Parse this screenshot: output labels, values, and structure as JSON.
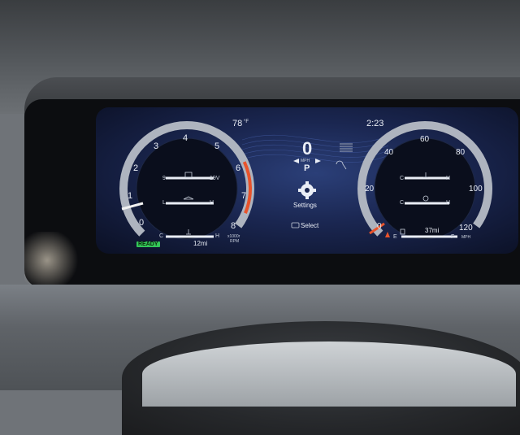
{
  "status": {
    "temperature": "78",
    "temp_unit": "°F",
    "time": "2:23"
  },
  "center": {
    "speed": "0",
    "speed_unit": "MPH",
    "gear": "P",
    "settings_label": "Settings",
    "select_label": "Select"
  },
  "tach": {
    "ticks": [
      "0",
      "1",
      "2",
      "3",
      "4",
      "5",
      "6",
      "7",
      "8"
    ],
    "unit_line1": "x1000r",
    "unit_line2": "RPM",
    "ready_label": "READY",
    "battery_low": "9",
    "battery_high": "19V",
    "oil_low": "L",
    "oil_high": "H",
    "temp_low": "C",
    "temp_high": "H",
    "trip": "12mi"
  },
  "speedo": {
    "ticks": [
      "0",
      "20",
      "40",
      "60",
      "80",
      "100",
      "120"
    ],
    "unit": "MPH",
    "gauge1_low": "C",
    "gauge1_high": "H",
    "gauge2_low": "C",
    "gauge2_high": "H",
    "fuel_empty": "E",
    "fuel_full": "F",
    "range": "37mi"
  },
  "colors": {
    "accent_red": "#e8532b",
    "ready_green": "#34c759",
    "screen_blue": "#1a2650"
  }
}
